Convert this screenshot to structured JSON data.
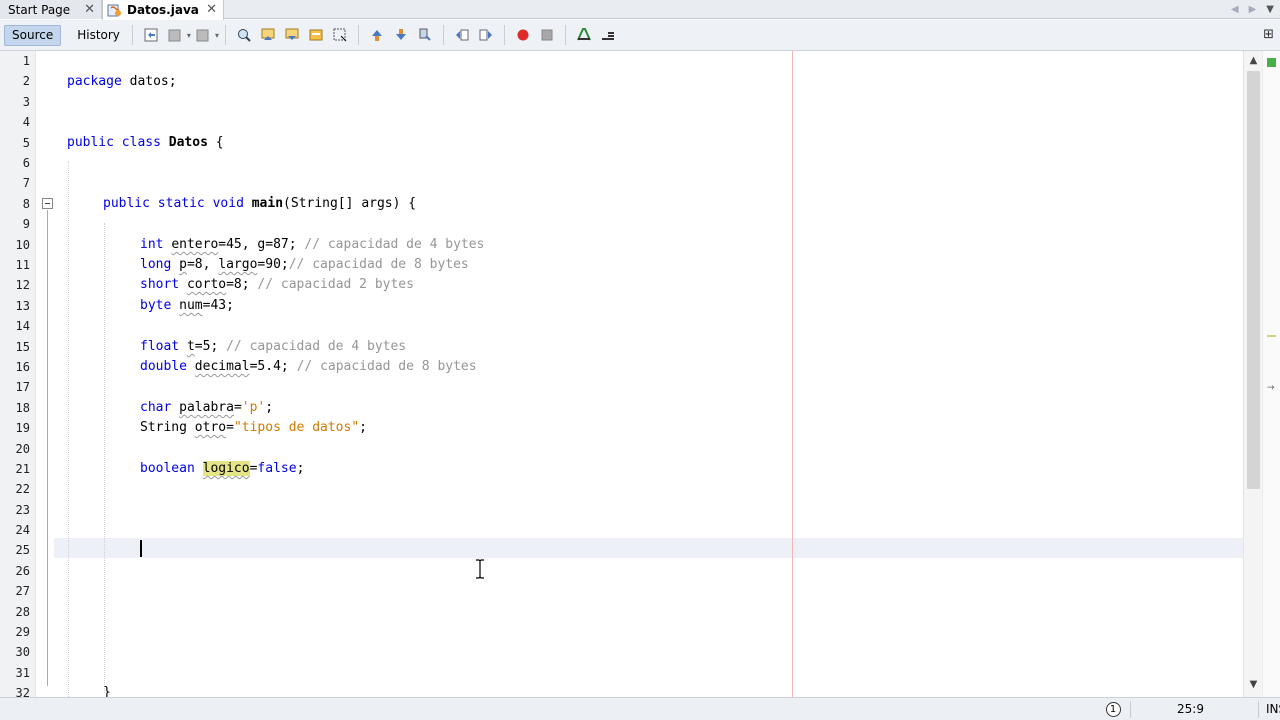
{
  "tabs": [
    {
      "label": "Start Page",
      "active": false
    },
    {
      "label": "Datos.java",
      "active": true
    }
  ],
  "toolbar": {
    "source_label": "Source",
    "history_label": "History"
  },
  "editor": {
    "line_numbers": [
      "1",
      "2",
      "3",
      "4",
      "5",
      "6",
      "7",
      "8",
      "9",
      "10",
      "11",
      "12",
      "13",
      "14",
      "15",
      "16",
      "17",
      "18",
      "19",
      "20",
      "21",
      "22",
      "23",
      "24",
      "25",
      "26",
      "27",
      "28",
      "29",
      "30",
      "31",
      "32"
    ],
    "code": {
      "l2": {
        "kw": "package",
        "rest": " datos;"
      },
      "l5": {
        "kw1": "public",
        "kw2": "class",
        "name": "Datos",
        "rest": " {"
      },
      "l8": {
        "kw1": "public",
        "kw2": "static",
        "kw3": "void",
        "name": "main",
        "rest": "(String[] args) {"
      },
      "l10": {
        "kw": "int",
        "v1": "entero",
        "mid": "=45, g=87; ",
        "cm": "// capacidad de 4 bytes"
      },
      "l11": {
        "kw": "long",
        "v1": "p",
        "mid1": "=8, ",
        "v2": "largo",
        "mid2": "=90;",
        "cm": "// capacidad de 8 bytes"
      },
      "l12": {
        "kw": "short",
        "v1": "corto",
        "mid": "=8; ",
        "cm": "// capacidad 2 bytes"
      },
      "l13": {
        "kw": "byte",
        "v1": "num",
        "mid": "=43;"
      },
      "l15": {
        "kw": "float",
        "v1": "t",
        "mid": "=5; ",
        "cm": "// capacidad de 4 bytes"
      },
      "l16": {
        "kw": "double",
        "v1": "decimal",
        "mid": "=5.4; ",
        "cm": "// capacidad de 8 bytes"
      },
      "l18": {
        "kw": "char",
        "v1": "palabra",
        "mid": "=",
        "str": "'p'",
        "end": ";"
      },
      "l19": {
        "type": "String",
        "v1": "otro",
        "mid": "=",
        "str": "\"tipos de datos\"",
        "end": ";"
      },
      "l21": {
        "kw": "boolean",
        "v1": "logico",
        "mid": "=",
        "kw2": "false",
        "end": ";"
      },
      "l32": {
        "rest": "}"
      }
    }
  },
  "status": {
    "notifications": "1",
    "position": "25:9",
    "mode": "INS"
  },
  "colors": {
    "keyword": "#0000e6",
    "comment": "#969696",
    "string": "#ce7b00",
    "highlight": "#e5e587",
    "margin_line": "#f3b6b6"
  }
}
